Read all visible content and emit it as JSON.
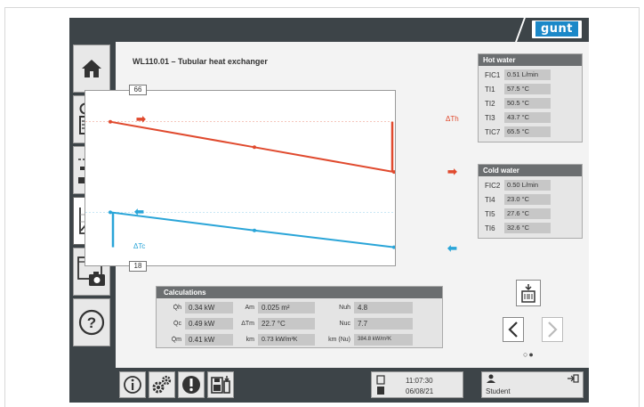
{
  "app": {
    "logo": "gunt",
    "title": "WL110.01 – Tubular heat exchanger"
  },
  "sidebar": {
    "items": [
      {
        "name": "home",
        "icon": "home-icon"
      },
      {
        "name": "glasses-manual",
        "icon": "glasses-book-icon"
      },
      {
        "name": "flow-diagram",
        "icon": "flow-diagram-icon"
      },
      {
        "name": "diagram",
        "icon": "chart-icon"
      },
      {
        "name": "screenshot",
        "icon": "camera-icon"
      },
      {
        "name": "help",
        "icon": "help-icon"
      }
    ]
  },
  "chart": {
    "y_max": "66",
    "y_min": "18",
    "delta_hot": "ΔTh",
    "delta_cold": "ΔTc",
    "hot_color": "#e04a2e",
    "cold_color": "#2aa5d8"
  },
  "chart_data": {
    "type": "line",
    "ylim": [
      18,
      66
    ],
    "series": [
      {
        "values": [
          57.5,
          50.5,
          43.7
        ]
      },
      {
        "values": [
          32.6,
          27.6,
          23.0
        ]
      }
    ]
  },
  "hot_water": {
    "title": "Hot water",
    "rows": [
      {
        "label": "FIC1",
        "value": "0.51 L/min"
      },
      {
        "label": "TI1",
        "value": "57.5 °C"
      },
      {
        "label": "TI2",
        "value": "50.5 °C"
      },
      {
        "label": "TI3",
        "value": "43.7 °C"
      },
      {
        "label": "TIC7",
        "value": "65.5 °C"
      }
    ]
  },
  "cold_water": {
    "title": "Cold water",
    "rows": [
      {
        "label": "FIC2",
        "value": "0.50 L/min"
      },
      {
        "label": "TI4",
        "value": "23.0 °C"
      },
      {
        "label": "TI5",
        "value": "27.6 °C"
      },
      {
        "label": "TI6",
        "value": "32.6 °C"
      }
    ]
  },
  "calculations": {
    "title": "Calculations",
    "rows": [
      [
        {
          "label": "Q̇h",
          "value": "0.34 kW"
        },
        {
          "label": "Am",
          "value": "0.025 m²"
        },
        {
          "label": "Nuh",
          "value": "4.8"
        }
      ],
      [
        {
          "label": "Q̇c",
          "value": "0.49 kW"
        },
        {
          "label": "ΔTm",
          "value": "22.7 °C"
        },
        {
          "label": "Nuc",
          "value": "7.7"
        }
      ],
      [
        {
          "label": "Q̇m",
          "value": "0.41 kW"
        },
        {
          "label": "km",
          "value": "0.73 kW/m²K"
        },
        {
          "label": "km (Nu)",
          "value": "384.8 kW/m²K"
        }
      ]
    ]
  },
  "status": {
    "time": "11:07:30",
    "date": "06/08/21",
    "user": "Student",
    "page_dots": "○●"
  }
}
